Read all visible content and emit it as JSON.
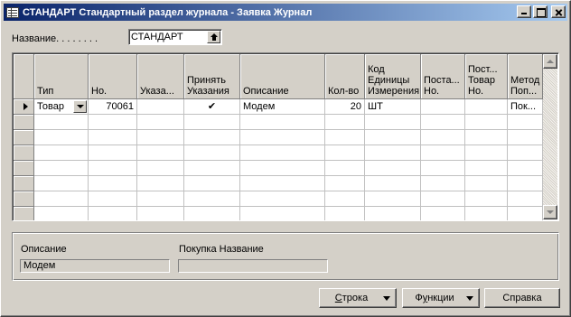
{
  "window": {
    "title": "СТАНДАРТ Стандартный раздел журнала - Заявка Журнал",
    "icon": "journal-icon"
  },
  "name_field": {
    "label": "Название. . . . . . . .",
    "value": "СТАНДАРТ",
    "lookup_icon": "lookup-arrow-icon"
  },
  "grid": {
    "columns": [
      {
        "key": "type",
        "label": "Тип"
      },
      {
        "key": "no",
        "label": "Но."
      },
      {
        "key": "instr",
        "label": "Указа..."
      },
      {
        "key": "accept",
        "label": "Принять\nУказания"
      },
      {
        "key": "desc",
        "label": "Описание"
      },
      {
        "key": "qty",
        "label": "Кол-во"
      },
      {
        "key": "uom",
        "label": "Код\nЕдиницы\nИзмерения"
      },
      {
        "key": "vendor",
        "label": "Поста...\nНо."
      },
      {
        "key": "vendor_item",
        "label": "Пост...\nТовар\nНо."
      },
      {
        "key": "method",
        "label": "Метод\nПоп..."
      }
    ],
    "rows": [
      {
        "type": "Товар",
        "no": "70061",
        "instr": "",
        "accept": "✔",
        "desc": "Модем",
        "qty": "20",
        "uom": "ШТ",
        "vendor": "",
        "vendor_item": "",
        "method": "Пок..."
      }
    ],
    "empty_rows": 7
  },
  "info": {
    "description_label": "Описание",
    "description_value": "Модем",
    "purchase_name_label": "Покупка Название",
    "purchase_name_value": ""
  },
  "buttons": {
    "line": {
      "prefix": "",
      "ul": "С",
      "suffix": "трока"
    },
    "functions": {
      "prefix": "Ф",
      "ul": "у",
      "suffix": "нкции"
    },
    "help": {
      "prefix": "",
      "ul": "",
      "suffix": "Справка"
    }
  }
}
